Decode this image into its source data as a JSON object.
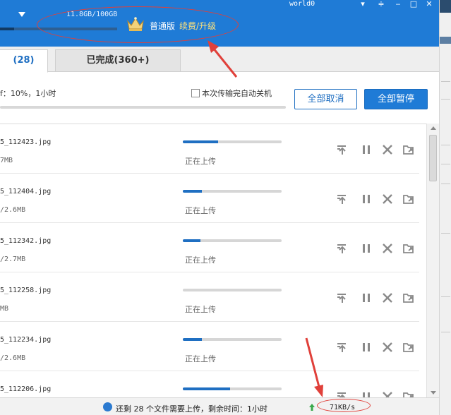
{
  "header": {
    "quota": "11.8GB/100GB",
    "quota_fraction": 0.118,
    "vip_label": "普通版",
    "upgrade_link": "续费/升级",
    "username": "world0",
    "window_controls": [
      "chevron-down-icon",
      "menu-icon",
      "minimize-icon",
      "close-icon"
    ]
  },
  "tabs": {
    "active": "(28)",
    "completed": "已完成(360+)"
  },
  "toolbar": {
    "progress_text": "f：10%，1小时",
    "overall_progress": 0.1,
    "shutdown_label": "本次传输完自动关机",
    "shutdown_checked": false,
    "cancel_all": "全部取消",
    "pause_all": "全部暂停"
  },
  "files": [
    {
      "name": "5_112423.jpg",
      "size": "7MB",
      "status": "正在上传",
      "progress": 0.36
    },
    {
      "name": "5_112404.jpg",
      "size": "/2.6MB",
      "status": "正在上传",
      "progress": 0.19
    },
    {
      "name": "5_112342.jpg",
      "size": "/2.7MB",
      "status": "正在上传",
      "progress": 0.18
    },
    {
      "name": "5_112258.jpg",
      "size": "MB",
      "status": "正在上传",
      "progress": 0.0
    },
    {
      "name": "5_112234.jpg",
      "size": "/2.6MB",
      "status": "正在上传",
      "progress": 0.19
    },
    {
      "name": "5_112206.jpg",
      "size": "",
      "status": "",
      "progress": 0.48
    }
  ],
  "row_actions": [
    "upload-first-icon",
    "pause-icon",
    "delete-icon",
    "open-folder-icon"
  ],
  "status_bar": {
    "remaining_text": "还剩 28 个文件需要上传，剩余时间：1小时",
    "speed": "71KB/s"
  },
  "colors": {
    "brand_blue": "#1f7bd6",
    "progress_blue": "#1f6fc2",
    "annotation_red": "#e0403a",
    "upgrade_yellow": "#ffe27a"
  }
}
